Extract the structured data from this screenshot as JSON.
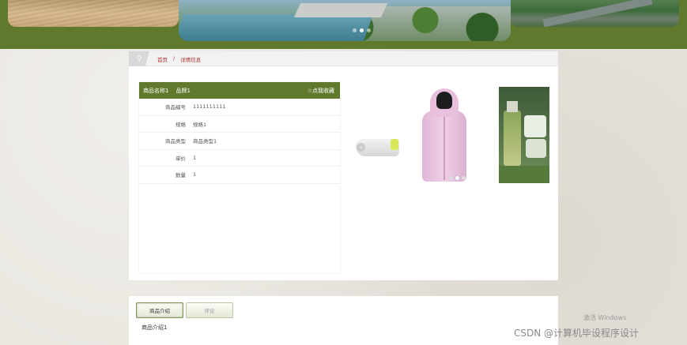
{
  "breadcrumb": {
    "home": "首页",
    "separator": "/",
    "current": "详情信息"
  },
  "product": {
    "name": "商品名称1",
    "brand": "品牌1",
    "favorite_label": "☆点我收藏",
    "fields": [
      {
        "label": "商品编号",
        "value": "1111111111"
      },
      {
        "label": "规格",
        "value": "规格1"
      },
      {
        "label": "商品类型",
        "value": "商品类型1"
      },
      {
        "label": "单价",
        "value": "1"
      },
      {
        "label": "数量",
        "value": "1"
      }
    ]
  },
  "gallery": {
    "images": [
      "sneaker-image",
      "pink-vest-image",
      "cosmetics-image"
    ],
    "active_index": 1
  },
  "tabs": {
    "items": [
      "商品介绍",
      "评论"
    ],
    "active_index": 0,
    "content": "商品介绍1"
  },
  "watermarks": {
    "windows": "激活 Windows",
    "csdn": "CSDN @计算机毕设程序设计"
  },
  "colors": {
    "accent": "#61792d",
    "breadcrumb": "#b03030"
  }
}
